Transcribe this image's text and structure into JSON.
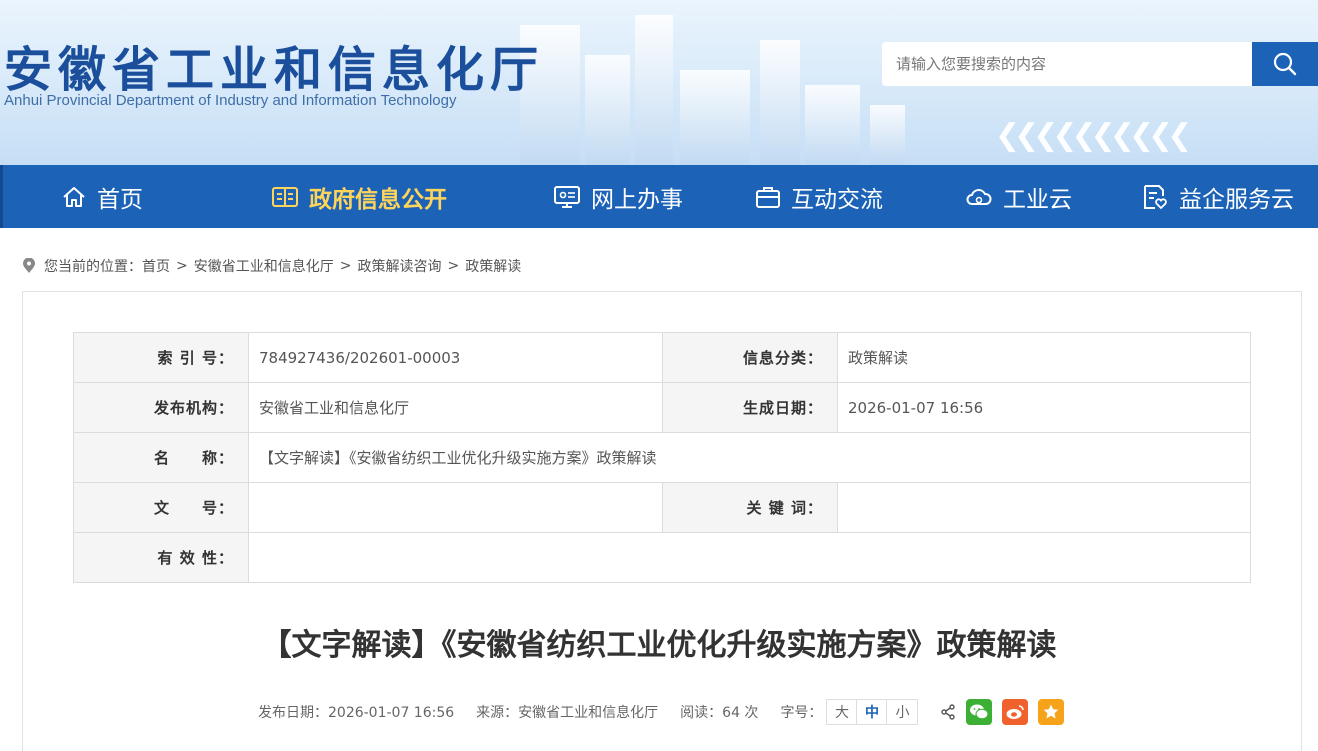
{
  "header": {
    "title": "安徽省工业和信息化厅",
    "subtitle": "Anhui Provincial Department of Industry and Information Technology",
    "search_placeholder": "请输入您要搜索的内容"
  },
  "nav": [
    {
      "label": "首页",
      "icon": "home-icon",
      "active": false
    },
    {
      "label": "政府信息公开",
      "icon": "book-icon",
      "active": true
    },
    {
      "label": "网上办事",
      "icon": "monitor-icon",
      "active": false
    },
    {
      "label": "互动交流",
      "icon": "briefcase-icon",
      "active": false
    },
    {
      "label": "工业云",
      "icon": "cloud-gear-icon",
      "active": false
    },
    {
      "label": "益企服务云",
      "icon": "document-heart-icon",
      "active": false
    }
  ],
  "breadcrumb": {
    "prefix": "您当前的位置：",
    "items": [
      "首页",
      "安徽省工业和信息化厅",
      "政策解读咨询",
      "政策解读"
    ],
    "separator": ">"
  },
  "meta": {
    "index_label": "索 引 号：",
    "index_value": "784927436/202601-00003",
    "category_label": "信息分类：",
    "category_value": "政策解读",
    "publisher_label": "发布机构：",
    "publisher_value": "安徽省工业和信息化厅",
    "date_label": "生成日期：",
    "date_value": "2026-01-07 16:56",
    "name_label": "名　　称：",
    "name_value": "【文字解读】《安徽省纺织工业优化升级实施方案》政策解读",
    "docno_label": "文　　号：",
    "docno_value": "",
    "keywords_label": "关 键 词：",
    "keywords_value": "",
    "validity_label": "有 效 性：",
    "validity_value": ""
  },
  "article": {
    "title": "【文字解读】《安徽省纺织工业优化升级实施方案》政策解读",
    "publish_date": "发布日期：2026-01-07 16:56",
    "source": "来源：安徽省工业和信息化厅",
    "reads": "阅读：64 次",
    "font_size_label": "字号：",
    "font_sizes": [
      "大",
      "中",
      "小"
    ]
  },
  "colors": {
    "nav_bg": "#1c63b8",
    "active_nav": "#ffd45a",
    "title_blue": "#1b4f9c",
    "wechat": "#3cb034",
    "weibo": "#f0622d",
    "favorite": "#f7a21b"
  }
}
